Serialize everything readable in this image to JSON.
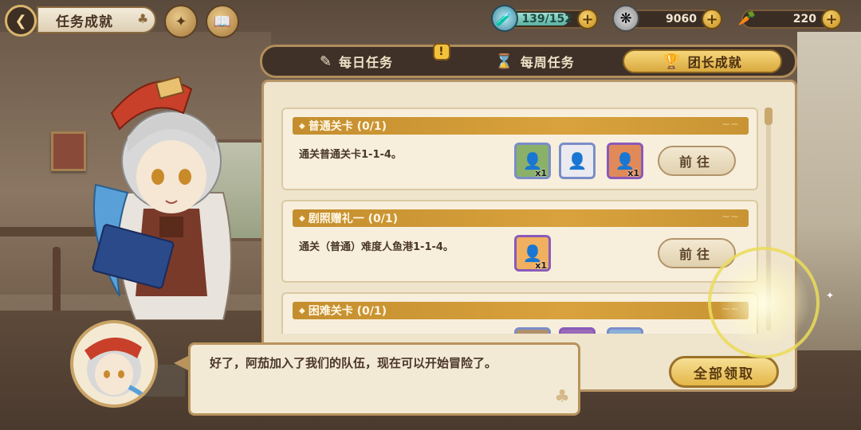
{
  "header": {
    "title": "任务成就",
    "resources": [
      {
        "name": "stamina",
        "icon": "stamina-potion-icon",
        "value": "139/152",
        "fraction": 0.91
      },
      {
        "name": "coins",
        "icon": "coin-icon",
        "value": "9060"
      },
      {
        "name": "carrots",
        "icon": "carrot-icon",
        "value": "220"
      }
    ]
  },
  "tabs": [
    {
      "label": "每日任务",
      "icon": "scroll-quill-icon",
      "badge": "!"
    },
    {
      "label": "每周任务",
      "icon": "hourglass-icon"
    },
    {
      "label": "团长成就",
      "icon": "trophy-icon",
      "active": true
    }
  ],
  "tasks": [
    {
      "title": "普通关卡 (0/1)",
      "desc": "通关普通关卡1-1-4。",
      "button": "前往",
      "rewards": [
        {
          "icon": "character-card-icon",
          "count": "x1"
        },
        {
          "icon": "character-card-icon",
          "count": ""
        },
        {
          "icon": "character-card-icon",
          "count": "x1"
        }
      ]
    },
    {
      "title": "剧照赠礼一 (0/1)",
      "desc": "通关（普通）难度人鱼港1-1-4。",
      "button": "前往",
      "rewards": [
        {
          "icon": "character-card-icon",
          "count": "x1"
        }
      ]
    },
    {
      "title": "困难关卡 (0/1)",
      "desc": "",
      "button": "",
      "rewards": []
    }
  ],
  "claim_all_label": "全部领取",
  "dialog": {
    "text": "好了，阿茄加入了我们的队伍，现在可以开始冒险了。"
  },
  "colors": {
    "accent": "#d9a23e",
    "panel": "#efe4cc",
    "tab_active": "#f6d77b"
  }
}
